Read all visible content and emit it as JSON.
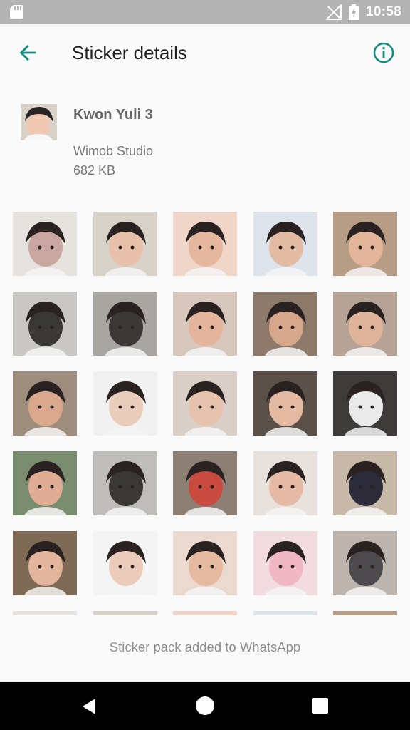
{
  "status_bar": {
    "time": "10:58",
    "icons": [
      "sd-card-icon",
      "no-signal-icon",
      "battery-charging-icon"
    ]
  },
  "app_bar": {
    "title": "Sticker details",
    "back_icon": "arrow-back-icon",
    "info_icon": "info-icon"
  },
  "pack": {
    "name": "Kwon Yuli 3",
    "publisher": "Wimob Studio",
    "size": "682 KB"
  },
  "stickers": [
    {
      "bg": "#e6e3df",
      "fg": "#c9a6a0"
    },
    {
      "bg": "#d8d2c8",
      "fg": "#e7c1a9"
    },
    {
      "bg": "#efd6c8",
      "fg": "#e5b79f"
    },
    {
      "bg": "#dde4ec",
      "fg": "#e2bba2"
    },
    {
      "bg": "#b89d86",
      "fg": "#e3b59a"
    },
    {
      "bg": "#c9c7c4",
      "fg": "#3a3835"
    },
    {
      "bg": "#a9a6a2",
      "fg": "#3b3836"
    },
    {
      "bg": "#d7c7bd",
      "fg": "#e4b59c"
    },
    {
      "bg": "#8d7a6a",
      "fg": "#d7a78b"
    },
    {
      "bg": "#b7a396",
      "fg": "#e0b39b"
    },
    {
      "bg": "#9e8d7c",
      "fg": "#d9a88d"
    },
    {
      "bg": "#f1f1f1",
      "fg": "#eaccbb"
    },
    {
      "bg": "#d9cfc6",
      "fg": "#e7c2ad"
    },
    {
      "bg": "#5b5149",
      "fg": "#e3b9a2"
    },
    {
      "bg": "#3f3b3a",
      "fg": "#eaeaea"
    },
    {
      "bg": "#7a8c6e",
      "fg": "#e0ac93"
    },
    {
      "bg": "#bfbdb9",
      "fg": "#3a3836"
    },
    {
      "bg": "#8e7f75",
      "fg": "#c94b3f"
    },
    {
      "bg": "#e9e1dc",
      "fg": "#e5baa5"
    },
    {
      "bg": "#c8b8a7",
      "fg": "#2b2b3a"
    },
    {
      "bg": "#7f6b55",
      "fg": "#e2b59c"
    },
    {
      "bg": "#f4f4f4",
      "fg": "#ebcbb9"
    },
    {
      "bg": "#ebd9cf",
      "fg": "#e6b9a1"
    },
    {
      "bg": "#f2dce0",
      "fg": "#f0b8c4"
    },
    {
      "bg": "#bcb4ad",
      "fg": "#4c4a4d"
    }
  ],
  "footer": {
    "message": "Sticker pack added to WhatsApp"
  },
  "nav_bar": {
    "icons": [
      "nav-back-icon",
      "nav-home-icon",
      "nav-recents-icon"
    ]
  }
}
